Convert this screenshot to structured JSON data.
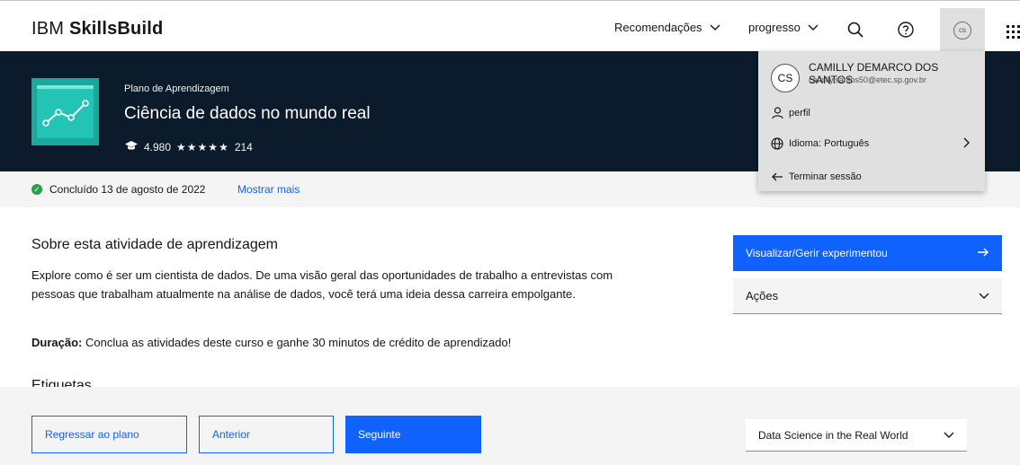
{
  "header": {
    "brand_prefix": "IBM",
    "brand_bold": "SkillsBuild",
    "nav": {
      "recommendations": "Recomendações",
      "progress": "progresso"
    },
    "avatar_initials": "cs"
  },
  "hero": {
    "eyebrow": "Plano de Aprendizagem",
    "title": "Ciência de dados no mundo real",
    "learners": "4.980",
    "rating_stars": "★★★★★",
    "reviews": "214"
  },
  "status": {
    "text": "Concluído 13 de agosto de 2022",
    "link": "Mostrar mais"
  },
  "main": {
    "about_heading": "Sobre esta atividade de aprendizagem",
    "about_text": "Explore como é ser um cientista de dados. De uma visão geral das oportunidades de trabalho a entrevistas com pessoas que trabalham atualmente na análise de dados, você terá uma ideia dessa carreira empolgante.",
    "duration_label": "Duração:",
    "duration_text": "Conclua as atividades deste curso e ganhe 30 minutos de crédito de aprendizado!",
    "tags_heading": "Etiquetas"
  },
  "side": {
    "primary_button": "Visualizar/Gerir experimentou",
    "actions": "Ações"
  },
  "footer": {
    "back": "Regressar ao plano",
    "previous": "Anterior",
    "next": "Seguinte",
    "course_select": "Data Science in the Real World"
  },
  "profile_menu": {
    "initials": "CS",
    "name": "CAMILLY DEMARCO DOS SANTOS",
    "email": "camilly.santos50@etec.sp.gov.br",
    "profile": "perfil",
    "language": "Idioma: Português",
    "logout": "Terminar sessão"
  },
  "colors": {
    "accent": "#0f62fe",
    "hero_bg": "#0b1b2b",
    "success": "#24a148"
  }
}
